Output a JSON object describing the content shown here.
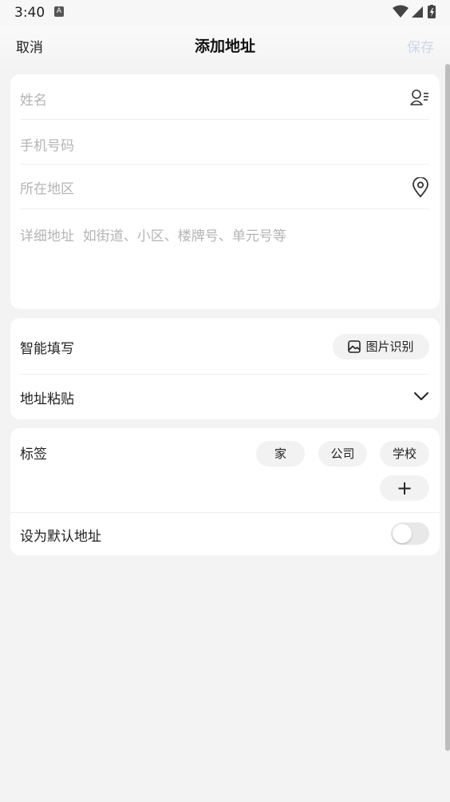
{
  "status_bar": {
    "time": "3:40",
    "icons": [
      "wifi-icon",
      "signal-icon",
      "battery-icon"
    ]
  },
  "nav": {
    "cancel": "取消",
    "title": "添加地址",
    "save": "保存"
  },
  "form": {
    "name_placeholder": "姓名",
    "phone_placeholder": "手机号码",
    "region_placeholder": "所在地区",
    "detail_placeholder": "详细地址  如街道、小区、楼牌号、单元号等"
  },
  "smart": {
    "label": "智能填写",
    "image_button": "图片识别",
    "paste_label": "地址粘贴"
  },
  "tags": {
    "label": "标签",
    "options": [
      "家",
      "公司",
      "学校"
    ],
    "add_symbol": "+"
  },
  "default_address": {
    "label": "设为默认地址",
    "enabled": false
  },
  "colors": {
    "save_disabled": "#cdd6e8",
    "placeholder": "#b4b4b4",
    "background": "#f3f3f3"
  }
}
